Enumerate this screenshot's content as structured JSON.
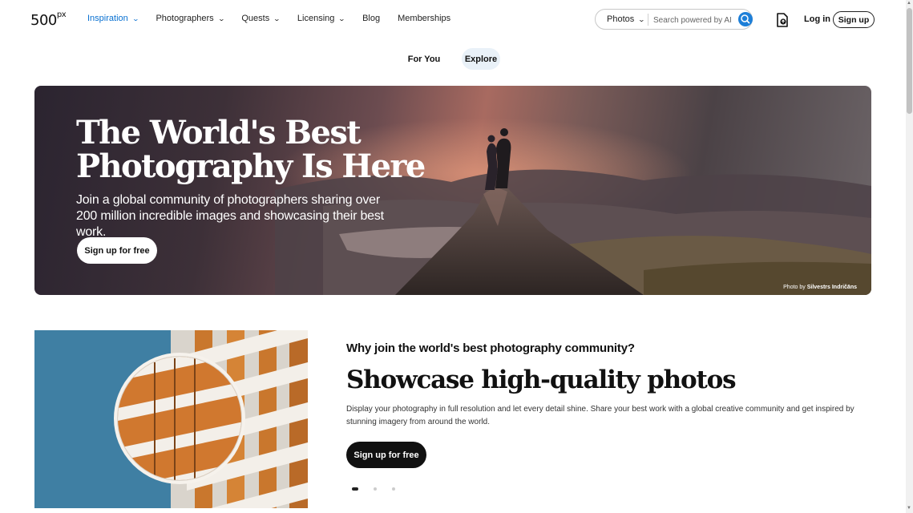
{
  "header": {
    "logo": "500",
    "logo_sup": "px",
    "nav": [
      {
        "label": "Inspiration",
        "has_menu": true,
        "active": true
      },
      {
        "label": "Photographers",
        "has_menu": true
      },
      {
        "label": "Quests",
        "has_menu": true
      },
      {
        "label": "Licensing",
        "has_menu": true
      },
      {
        "label": "Blog",
        "has_menu": false
      },
      {
        "label": "Memberships",
        "has_menu": false
      }
    ],
    "search": {
      "type": "Photos",
      "placeholder": "Search powered by AI",
      "button_icon": "search-icon"
    },
    "upload_icon": "upload-icon",
    "login_label": "Log in",
    "signup_label": "Sign up"
  },
  "tabs": [
    {
      "label": "For You",
      "active": false
    },
    {
      "label": "Explore",
      "active": true
    }
  ],
  "hero": {
    "title": "The World's Best Photography Is Here",
    "subtitle": "Join a global community of photographers sharing over 200 million incredible images and showcasing their best work.",
    "button": "Sign up for free",
    "credit_prefix": "Photo by",
    "credit_name": "Silvestrs Indričāns"
  },
  "feature": {
    "heading": "Why join the world's best photography community?",
    "title": "Showcase high-quality photos",
    "description": "Display your photography in full resolution and let every detail shine. Share your best work with a global creative community and get inspired by stunning imagery from around the world.",
    "button": "Sign up for free",
    "carousel_index": 0,
    "carousel_count": 3
  },
  "colors": {
    "accent": "#0870d1",
    "search_button": "#1d7fd8",
    "explore_tab_bg": "#e9f1f8"
  }
}
